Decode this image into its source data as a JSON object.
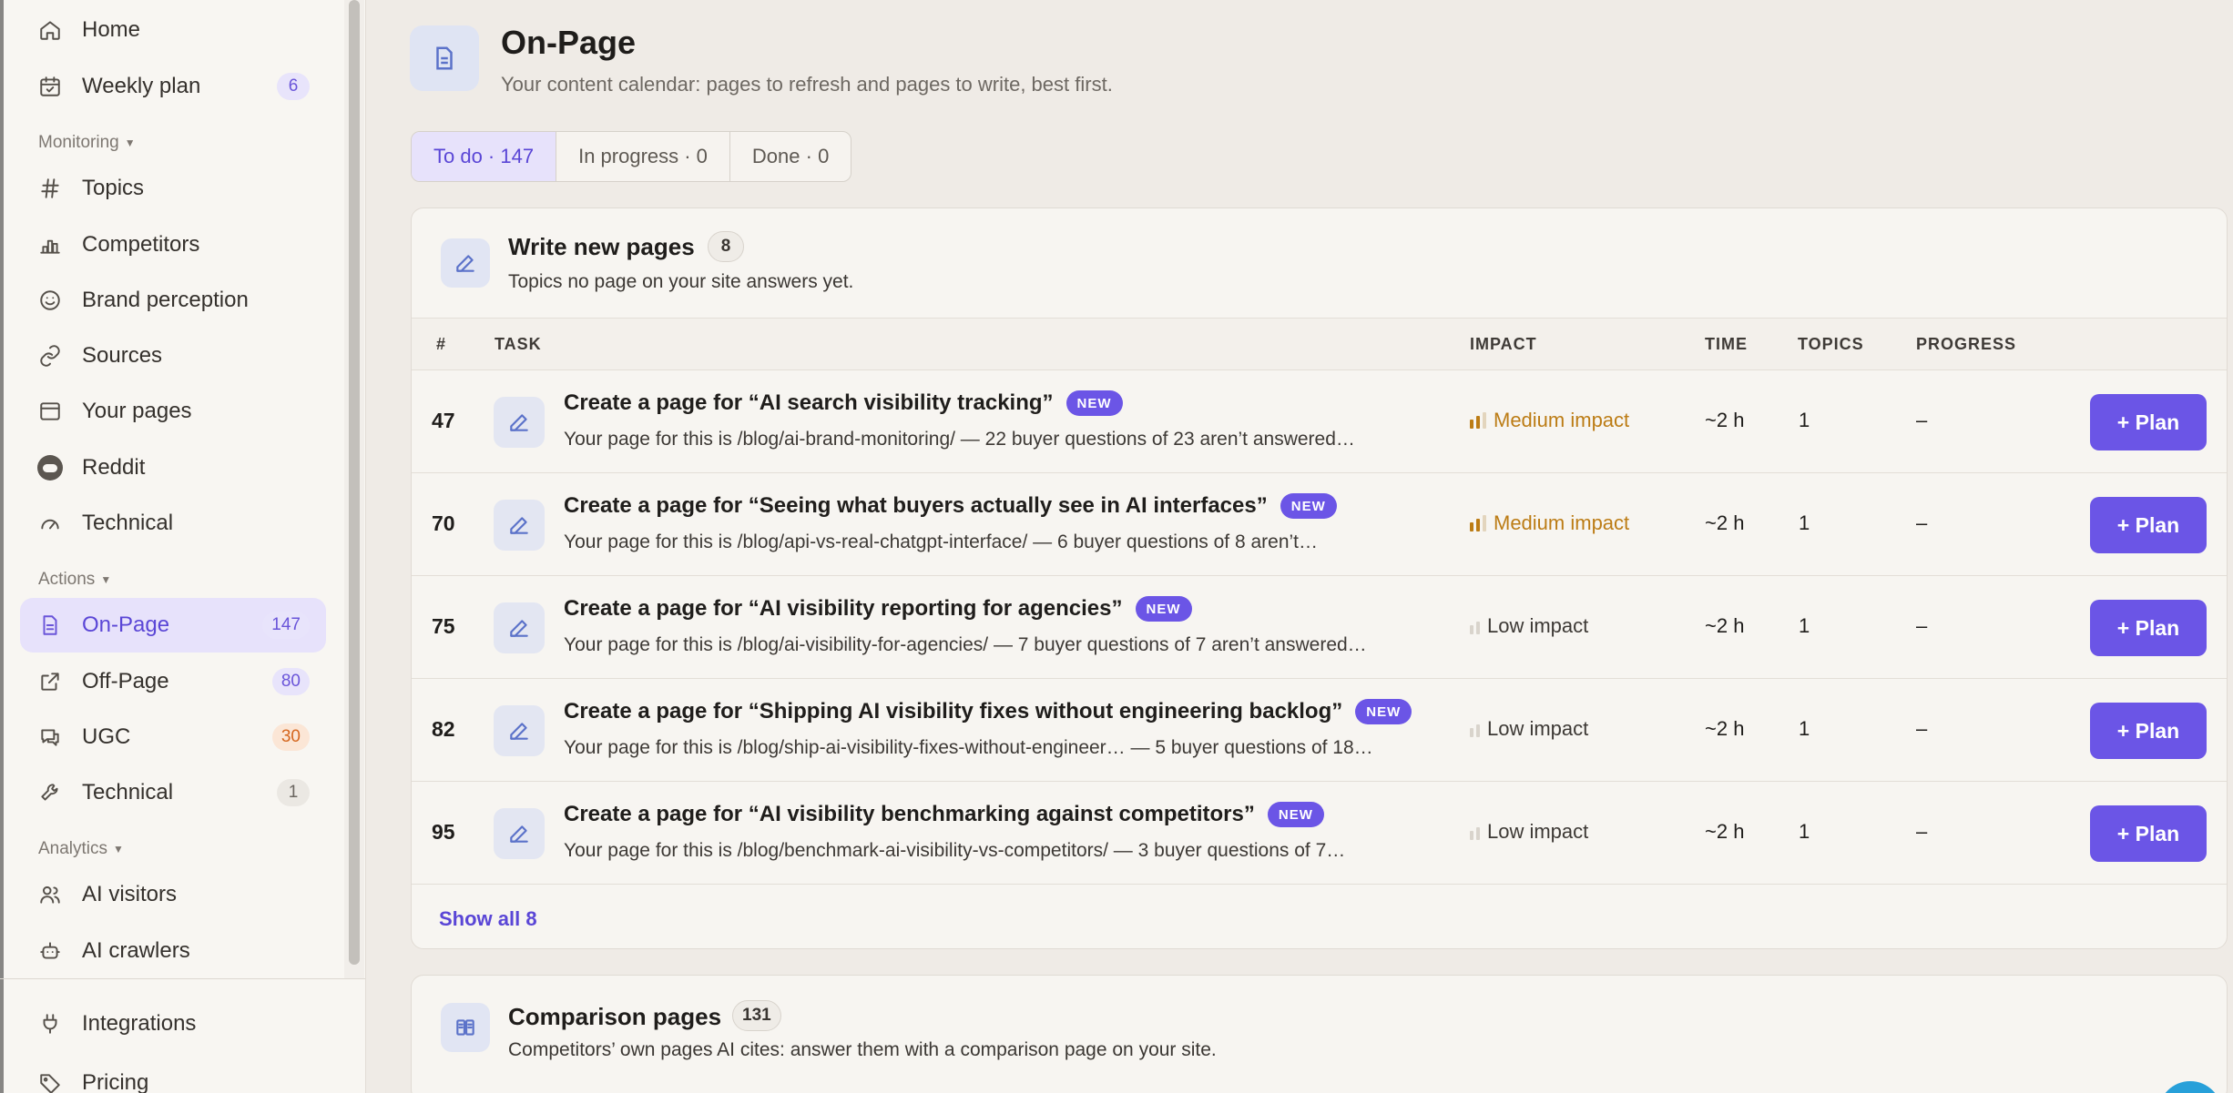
{
  "sidebar": {
    "items_top": [
      {
        "label": "Home",
        "icon": "home-icon"
      },
      {
        "label": "Weekly plan",
        "icon": "calendar-icon",
        "count": "6"
      }
    ],
    "monitoring_label": "Monitoring",
    "monitoring": [
      {
        "label": "Topics",
        "icon": "hash-icon"
      },
      {
        "label": "Competitors",
        "icon": "bar-chart-icon"
      },
      {
        "label": "Brand perception",
        "icon": "smile-icon"
      },
      {
        "label": "Sources",
        "icon": "link-icon"
      },
      {
        "label": "Your pages",
        "icon": "browser-icon"
      },
      {
        "label": "Reddit",
        "icon": "reddit-icon"
      },
      {
        "label": "Technical",
        "icon": "gauge-icon"
      }
    ],
    "actions_label": "Actions",
    "actions": [
      {
        "label": "On-Page",
        "icon": "document-icon",
        "count": "147",
        "active": true
      },
      {
        "label": "Off-Page",
        "icon": "external-link-icon",
        "count": "80"
      },
      {
        "label": "UGC",
        "icon": "chat-icon",
        "count": "30",
        "count_color": "#d5661e"
      },
      {
        "label": "Technical",
        "icon": "wrench-icon",
        "count": "1"
      }
    ],
    "analytics_label": "Analytics",
    "analytics": [
      {
        "label": "AI visitors",
        "icon": "users-icon"
      },
      {
        "label": "AI crawlers",
        "icon": "bot-icon"
      }
    ],
    "bottom": [
      {
        "label": "Integrations",
        "icon": "plug-icon"
      },
      {
        "label": "Pricing",
        "icon": "tag-icon"
      }
    ]
  },
  "header": {
    "title": "On-Page",
    "subtitle": "Your content calendar: pages to refresh and pages to write, best first.",
    "icon": "document-icon"
  },
  "tabs": [
    {
      "label": "To do · 147",
      "active": true
    },
    {
      "label": "In progress · 0"
    },
    {
      "label": "Done · 0"
    }
  ],
  "write_card": {
    "title": "Write new pages",
    "count": "8",
    "description": "Topics no page on your site answers yet.",
    "columns": [
      "#",
      "TASK",
      "IMPACT",
      "TIME",
      "TOPICS",
      "PROGRESS"
    ],
    "rows": [
      {
        "num": "47",
        "title": "Create a page for “AI search visibility tracking”",
        "badge": "NEW",
        "desc": "Your page for this is /blog/ai-brand-monitoring/ — 22 buyer questions of 23 aren’t answered…",
        "impact": "Medium impact",
        "impact_level": "medium",
        "time": "~2 h",
        "topics": "1",
        "progress": "–",
        "action": "+ Plan"
      },
      {
        "num": "70",
        "title": "Create a page for “Seeing what buyers actually see in AI interfaces”",
        "badge": "NEW",
        "desc": "Your page for this is /blog/api-vs-real-chatgpt-interface/ — 6 buyer questions of 8 aren’t…",
        "impact": "Medium impact",
        "impact_level": "medium",
        "time": "~2 h",
        "topics": "1",
        "progress": "–",
        "action": "+ Plan"
      },
      {
        "num": "75",
        "title": "Create a page for “AI visibility reporting for agencies”",
        "badge": "NEW",
        "desc": "Your page for this is /blog/ai-visibility-for-agencies/ — 7 buyer questions of 7 aren’t answered…",
        "impact": "Low impact",
        "impact_level": "low",
        "time": "~2 h",
        "topics": "1",
        "progress": "–",
        "action": "+ Plan"
      },
      {
        "num": "82",
        "title": "Create a page for “Shipping AI visibility fixes without engineering backlog”",
        "badge": "NEW",
        "desc": "Your page for this is /blog/ship-ai-visibility-fixes-without-engineer… — 5 buyer questions of 18…",
        "impact": "Low impact",
        "impact_level": "low",
        "time": "~2 h",
        "topics": "1",
        "progress": "–",
        "action": "+ Plan"
      },
      {
        "num": "95",
        "title": "Create a page for “AI visibility benchmarking against competitors”",
        "badge": "NEW",
        "desc": "Your page for this is /blog/benchmark-ai-visibility-vs-competitors/ — 3 buyer questions of 7…",
        "impact": "Low impact",
        "impact_level": "low",
        "time": "~2 h",
        "topics": "1",
        "progress": "–",
        "action": "+ Plan"
      }
    ],
    "show_all": "Show all 8"
  },
  "comparison_card": {
    "title": "Comparison pages",
    "count": "131",
    "description": "Competitors’ own pages AI cites: answer them with a comparison page on your site."
  },
  "colors": {
    "accent": "#6b55e6",
    "medium_impact": "#bc7c15",
    "background": "#efebe6"
  }
}
